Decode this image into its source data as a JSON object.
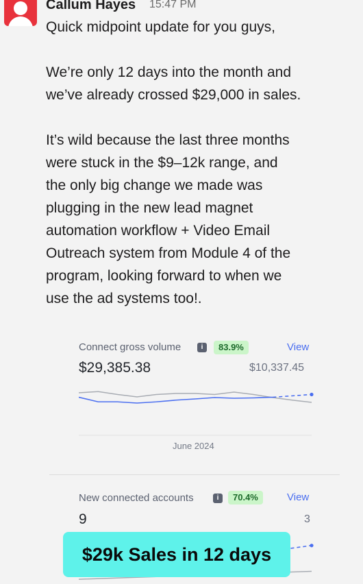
{
  "message": {
    "sender": "Callum Hayes",
    "time": "15:47 PM",
    "lines": [
      "Quick midpoint update for you guys,",
      "",
      "We’re only 12 days into the month and",
      "we’ve already crossed $29,000 in sales.",
      "",
      "It’s wild because the last three months",
      "were stuck in the $9–12k range, and",
      "the only big change we made was",
      "plugging in the new lead magnet",
      "automation workflow + Video Email",
      "Outreach system from Module 4 of the",
      "program, looking forward to when we",
      "use the ad systems too!."
    ]
  },
  "card1": {
    "title": "Connect gross volume",
    "info_icon": "info-icon",
    "badge": "83.9%",
    "view_label": "View",
    "value": "$29,385.38",
    "compare_value": "$10,337.45",
    "period_label": "June 2024"
  },
  "card2": {
    "title": "New connected accounts",
    "info_icon": "info-icon",
    "badge": "70.4%",
    "view_label": "View",
    "value": "9",
    "compare_value": "3"
  },
  "caption": "$29k Sales in 12 days",
  "colors": {
    "avatar": "#e8323c",
    "current_line": "#4a6ef0",
    "previous_line": "#a8acb3",
    "badge_bg": "#cbf5c9",
    "caption_bg": "#5ef2ea"
  },
  "chart_data": [
    {
      "type": "line",
      "title": "Connect gross volume",
      "x": [
        1,
        2,
        3,
        4,
        5,
        6,
        7,
        8,
        9,
        10,
        11,
        12,
        13
      ],
      "series": [
        {
          "values": [
            8.2,
            5.5,
            5.5,
            4.8,
            5.5,
            6.5,
            7.2,
            8.0,
            7.6,
            7.8,
            8.2,
            9.0,
            9.8
          ],
          "style": "solid-then-dashed"
        },
        {
          "values": [
            10.8,
            11.5,
            9.8,
            8.4,
            9.8,
            10.4,
            10.4,
            9.8,
            11.2,
            9.8,
            8.0,
            6.5,
            5.2
          ]
        }
      ],
      "xlabel": "June 2024",
      "grid": false
    },
    {
      "type": "line",
      "title": "New connected accounts",
      "x": [
        1,
        2,
        3,
        4,
        5
      ],
      "series": [
        {
          "values": [
            4.5,
            5.0,
            6.0,
            7.5,
            9.0
          ],
          "style": "dashed"
        },
        {
          "values": [
            0.5,
            1.0,
            1.5,
            2.0,
            2.5
          ]
        }
      ],
      "grid": false
    }
  ]
}
